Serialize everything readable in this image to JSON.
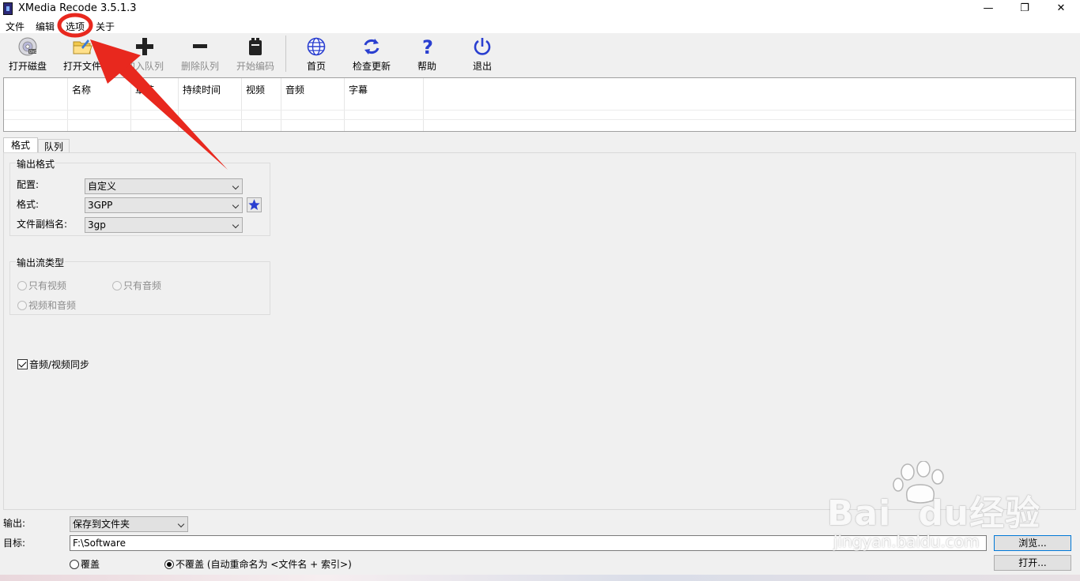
{
  "window": {
    "title": "XMedia Recode 3.5.1.3",
    "minimize_glyph": "—",
    "maximize_glyph": "❐",
    "close_glyph": "✕"
  },
  "menu": {
    "items": [
      "文件",
      "编辑",
      "选项",
      "关于"
    ]
  },
  "toolbar": {
    "buttons": [
      {
        "label": "打开磁盘",
        "icon": "dvd-disc-icon",
        "enabled": true
      },
      {
        "label": "打开文件",
        "icon": "open-folder-icon",
        "enabled": true
      },
      {
        "label": "加入队列",
        "icon": "plus-icon",
        "enabled": false
      },
      {
        "label": "删除队列",
        "icon": "minus-icon",
        "enabled": false
      },
      {
        "label": "开始编码",
        "icon": "encode-icon",
        "enabled": false
      },
      {
        "label": "首页",
        "icon": "globe-icon",
        "enabled": true
      },
      {
        "label": "检查更新",
        "icon": "refresh-icon",
        "enabled": true
      },
      {
        "label": "帮助",
        "icon": "help-icon",
        "enabled": true
      },
      {
        "label": "退出",
        "icon": "power-icon",
        "enabled": true
      }
    ]
  },
  "file_list": {
    "columns": [
      "",
      "名称",
      "章节",
      "持续时间",
      "视频",
      "音频",
      "字幕"
    ]
  },
  "tabs": {
    "format": "格式",
    "queue": "队列"
  },
  "output_format": {
    "group_title": "输出格式",
    "profile_label": "配置:",
    "profile_value": "自定义",
    "format_label": "格式:",
    "format_value": "3GPP",
    "extension_label": "文件副档名:",
    "extension_value": "3gp"
  },
  "stream_type": {
    "group_title": "输出流类型",
    "video_only": "只有视频",
    "audio_only": "只有音频",
    "video_and_audio": "视频和音频"
  },
  "av_sync": {
    "label": "音频/视频同步",
    "checked": true
  },
  "bottom": {
    "output_label": "输出:",
    "output_value": "保存到文件夹",
    "target_label": "目标:",
    "target_value": "F:\\Software",
    "browse_button": "浏览...",
    "overwrite_label": "覆盖",
    "no_overwrite_label": "不覆盖 (自动重命名为 <文件名 + 索引>)",
    "open_button": "打开..."
  },
  "watermark": {
    "brand": "Bai",
    "brand_du": "du",
    "chinese": "经验",
    "url": "jingyan.baidu.com"
  },
  "colors": {
    "annotation_red": "#e8281e",
    "disabled_text": "#8c8c8c",
    "focus_blue": "#0078d7"
  }
}
